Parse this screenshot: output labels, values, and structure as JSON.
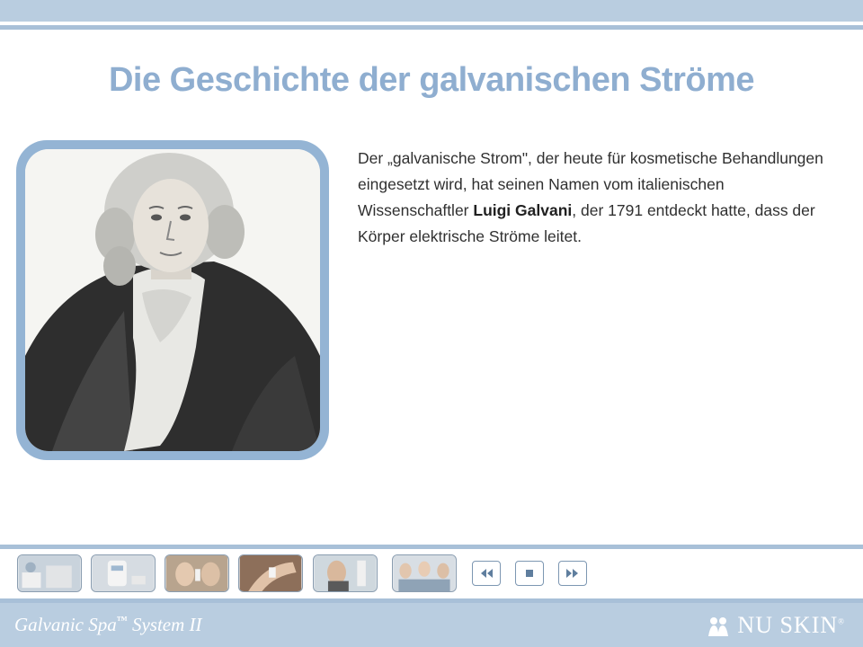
{
  "slide": {
    "title": "Die Geschichte der galvanischen Ströme",
    "paragraph": {
      "before": "Der „galvanische Strom\", der heute für kosmetische Behandlungen eingesetzt wird, hat seinen Namen vom italienischen Wissenschaftler ",
      "bold": "Luigi Galvani",
      "after": ", der 1791 entdeckt hatte, dass der Körper elektrische Ströme leitet."
    }
  },
  "nav": {
    "thumbnails": [
      "spa-device-thumbnail",
      "galvanic-unit-thumbnail",
      "woman-face-treatment-thumbnail",
      "arm-treatment-thumbnail",
      "man-treatment-thumbnail",
      "group-women-thumbnail"
    ],
    "controls": [
      "rewind-icon",
      "stop-icon",
      "fast-forward-icon"
    ]
  },
  "footer": {
    "brand": "Galvanic Spa",
    "brand_mark": "™",
    "brand_suffix": " System II",
    "logo_text": "NU SKIN",
    "logo_mark": "®"
  },
  "colors": {
    "accent": "#8faed0",
    "band": "#b9cde0",
    "frame": "#94b4d4"
  }
}
